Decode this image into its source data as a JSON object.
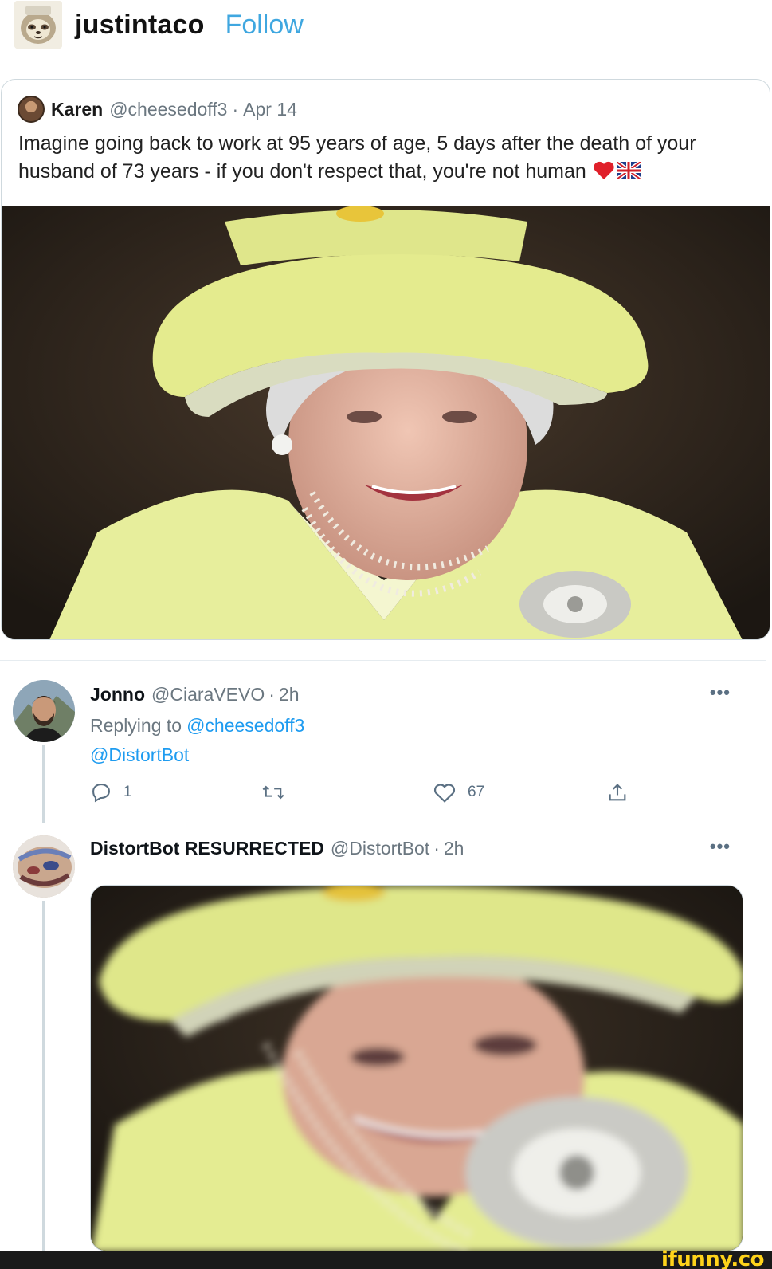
{
  "tumblr": {
    "username": "justintaco",
    "follow_label": "Follow",
    "avatar_icon": "sloth-avatar"
  },
  "quoted_tweet": {
    "author_name": "Karen",
    "handle": "@cheesedoff3",
    "separator": "·",
    "date": "Apr 14",
    "text": "Imagine going back to work at 95 years of age, 5 days after the death of your husband of 73 years - if you don't respect that, you're not human",
    "emoji_icons": [
      "red-heart-icon",
      "uk-flag-icon"
    ]
  },
  "reply_tweet": {
    "author_name": "Jonno",
    "handle": "@CiaraVEVO",
    "separator": "·",
    "time": "2h",
    "more_label": "•••",
    "replying_to_prefix": "Replying to",
    "replying_to_handle": "@cheesedoff3",
    "text": "@DistortBot",
    "actions": {
      "reply_count": "1",
      "retweet_count": "",
      "like_count": "67"
    }
  },
  "bot_tweet": {
    "author_name": "DistortBot RESURRECTED",
    "handle": "@DistortBot",
    "separator": "·",
    "time": "2h",
    "more_label": "•••"
  },
  "footer": {
    "watermark": "ifunny.co"
  },
  "colors": {
    "follow_blue": "#3fa7e0",
    "link_blue": "#1d9bf0",
    "muted_gray": "#6b7780",
    "hat_yellow": "#e4eb8e"
  }
}
